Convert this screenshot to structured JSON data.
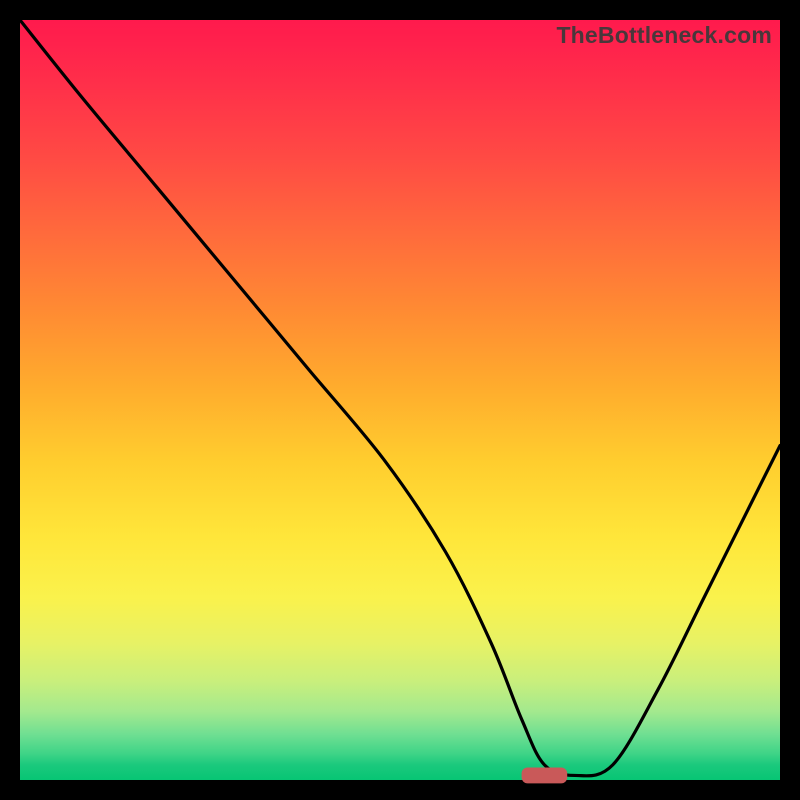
{
  "watermark": "TheBottleneck.com",
  "chart_data": {
    "type": "line",
    "title": "",
    "xlabel": "",
    "ylabel": "",
    "xlim": [
      0,
      100
    ],
    "ylim": [
      0,
      100
    ],
    "curve": {
      "x": [
        0,
        8,
        18,
        28,
        38,
        48,
        56,
        62,
        66,
        69,
        73,
        78,
        84,
        90,
        96,
        100
      ],
      "y": [
        100,
        90,
        78,
        66,
        54,
        42,
        30,
        18,
        8,
        2,
        0.6,
        2,
        12,
        24,
        36,
        44
      ]
    },
    "marker": {
      "x": 69,
      "y": 0.6,
      "width": 6,
      "height": 2.1
    }
  }
}
